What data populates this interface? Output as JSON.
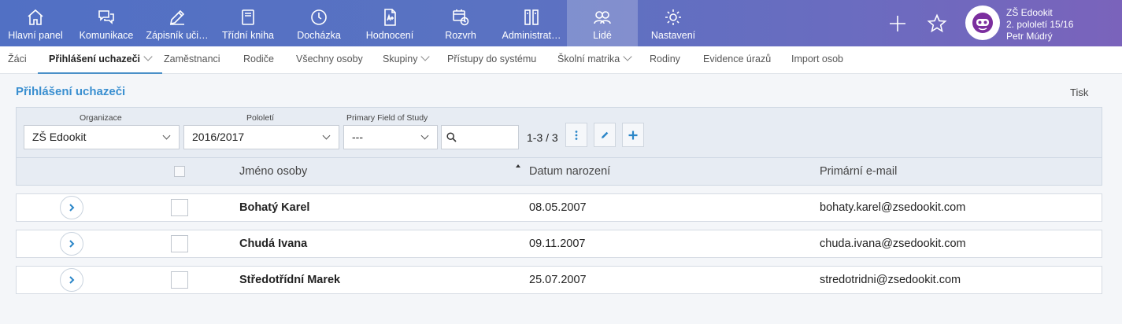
{
  "nav": {
    "items": [
      {
        "label": "Hlavní panel",
        "icon": "home-icon"
      },
      {
        "label": "Komunikace",
        "icon": "chat-icon"
      },
      {
        "label": "Zápisník uči…",
        "icon": "pencil-icon"
      },
      {
        "label": "Třídní kniha",
        "icon": "book-icon"
      },
      {
        "label": "Docházka",
        "icon": "clock-icon"
      },
      {
        "label": "Hodnocení",
        "icon": "grade-document-icon"
      },
      {
        "label": "Rozvrh",
        "icon": "schedule-icon"
      },
      {
        "label": "Administrat…",
        "icon": "admin-icon"
      },
      {
        "label": "Lidé",
        "icon": "people-icon"
      },
      {
        "label": "Nastavení",
        "icon": "gear-icon"
      }
    ],
    "active": "Lidé"
  },
  "user": {
    "school": "ZŠ Edookit",
    "term": "2. pololetí 15/16",
    "name": "Petr Múdrý"
  },
  "subnav": {
    "items": [
      {
        "label": "Žáci"
      },
      {
        "label": "Přihlášení uchazeči"
      },
      {
        "label": "Zaměstnanci"
      },
      {
        "label": "Rodiče"
      },
      {
        "label": "Všechny osoby"
      },
      {
        "label": "Skupiny"
      },
      {
        "label": "Přístupy do systému"
      },
      {
        "label": "Školní matrika"
      },
      {
        "label": "Rodiny"
      },
      {
        "label": "Evidence úrazů"
      },
      {
        "label": "Import osob"
      }
    ],
    "active": "Přihlášení uchazeči"
  },
  "page": {
    "title": "Přihlášení uchazeči",
    "print": "Tisk"
  },
  "filters": {
    "organization": {
      "label": "Organizace",
      "value": "ZŠ Edookit"
    },
    "term": {
      "label": "Pololetí",
      "value": "2016/2017"
    },
    "field": {
      "label": "Primary Field of Study",
      "value": "---"
    },
    "search": {
      "value": ""
    },
    "count": "1-3 / 3"
  },
  "table": {
    "columns": {
      "name": "Jméno osoby",
      "birth": "Datum narození",
      "email": "Primární e-mail"
    },
    "rows": [
      {
        "name": "Bohatý Karel",
        "birth": "08.05.2007",
        "email": "bohaty.karel@zsedookit.com"
      },
      {
        "name": "Chudá Ivana",
        "birth": "09.11.2007",
        "email": "chuda.ivana@zsedookit.com"
      },
      {
        "name": "Středotřídní Marek",
        "birth": "25.07.2007",
        "email": "stredotridni@zsedookit.com"
      }
    ]
  },
  "colors": {
    "nav_gradient_start": "#5170c4",
    "nav_gradient_end": "#7a63bb",
    "accent": "#3a8fd0",
    "panel": "#e7ecf3"
  }
}
